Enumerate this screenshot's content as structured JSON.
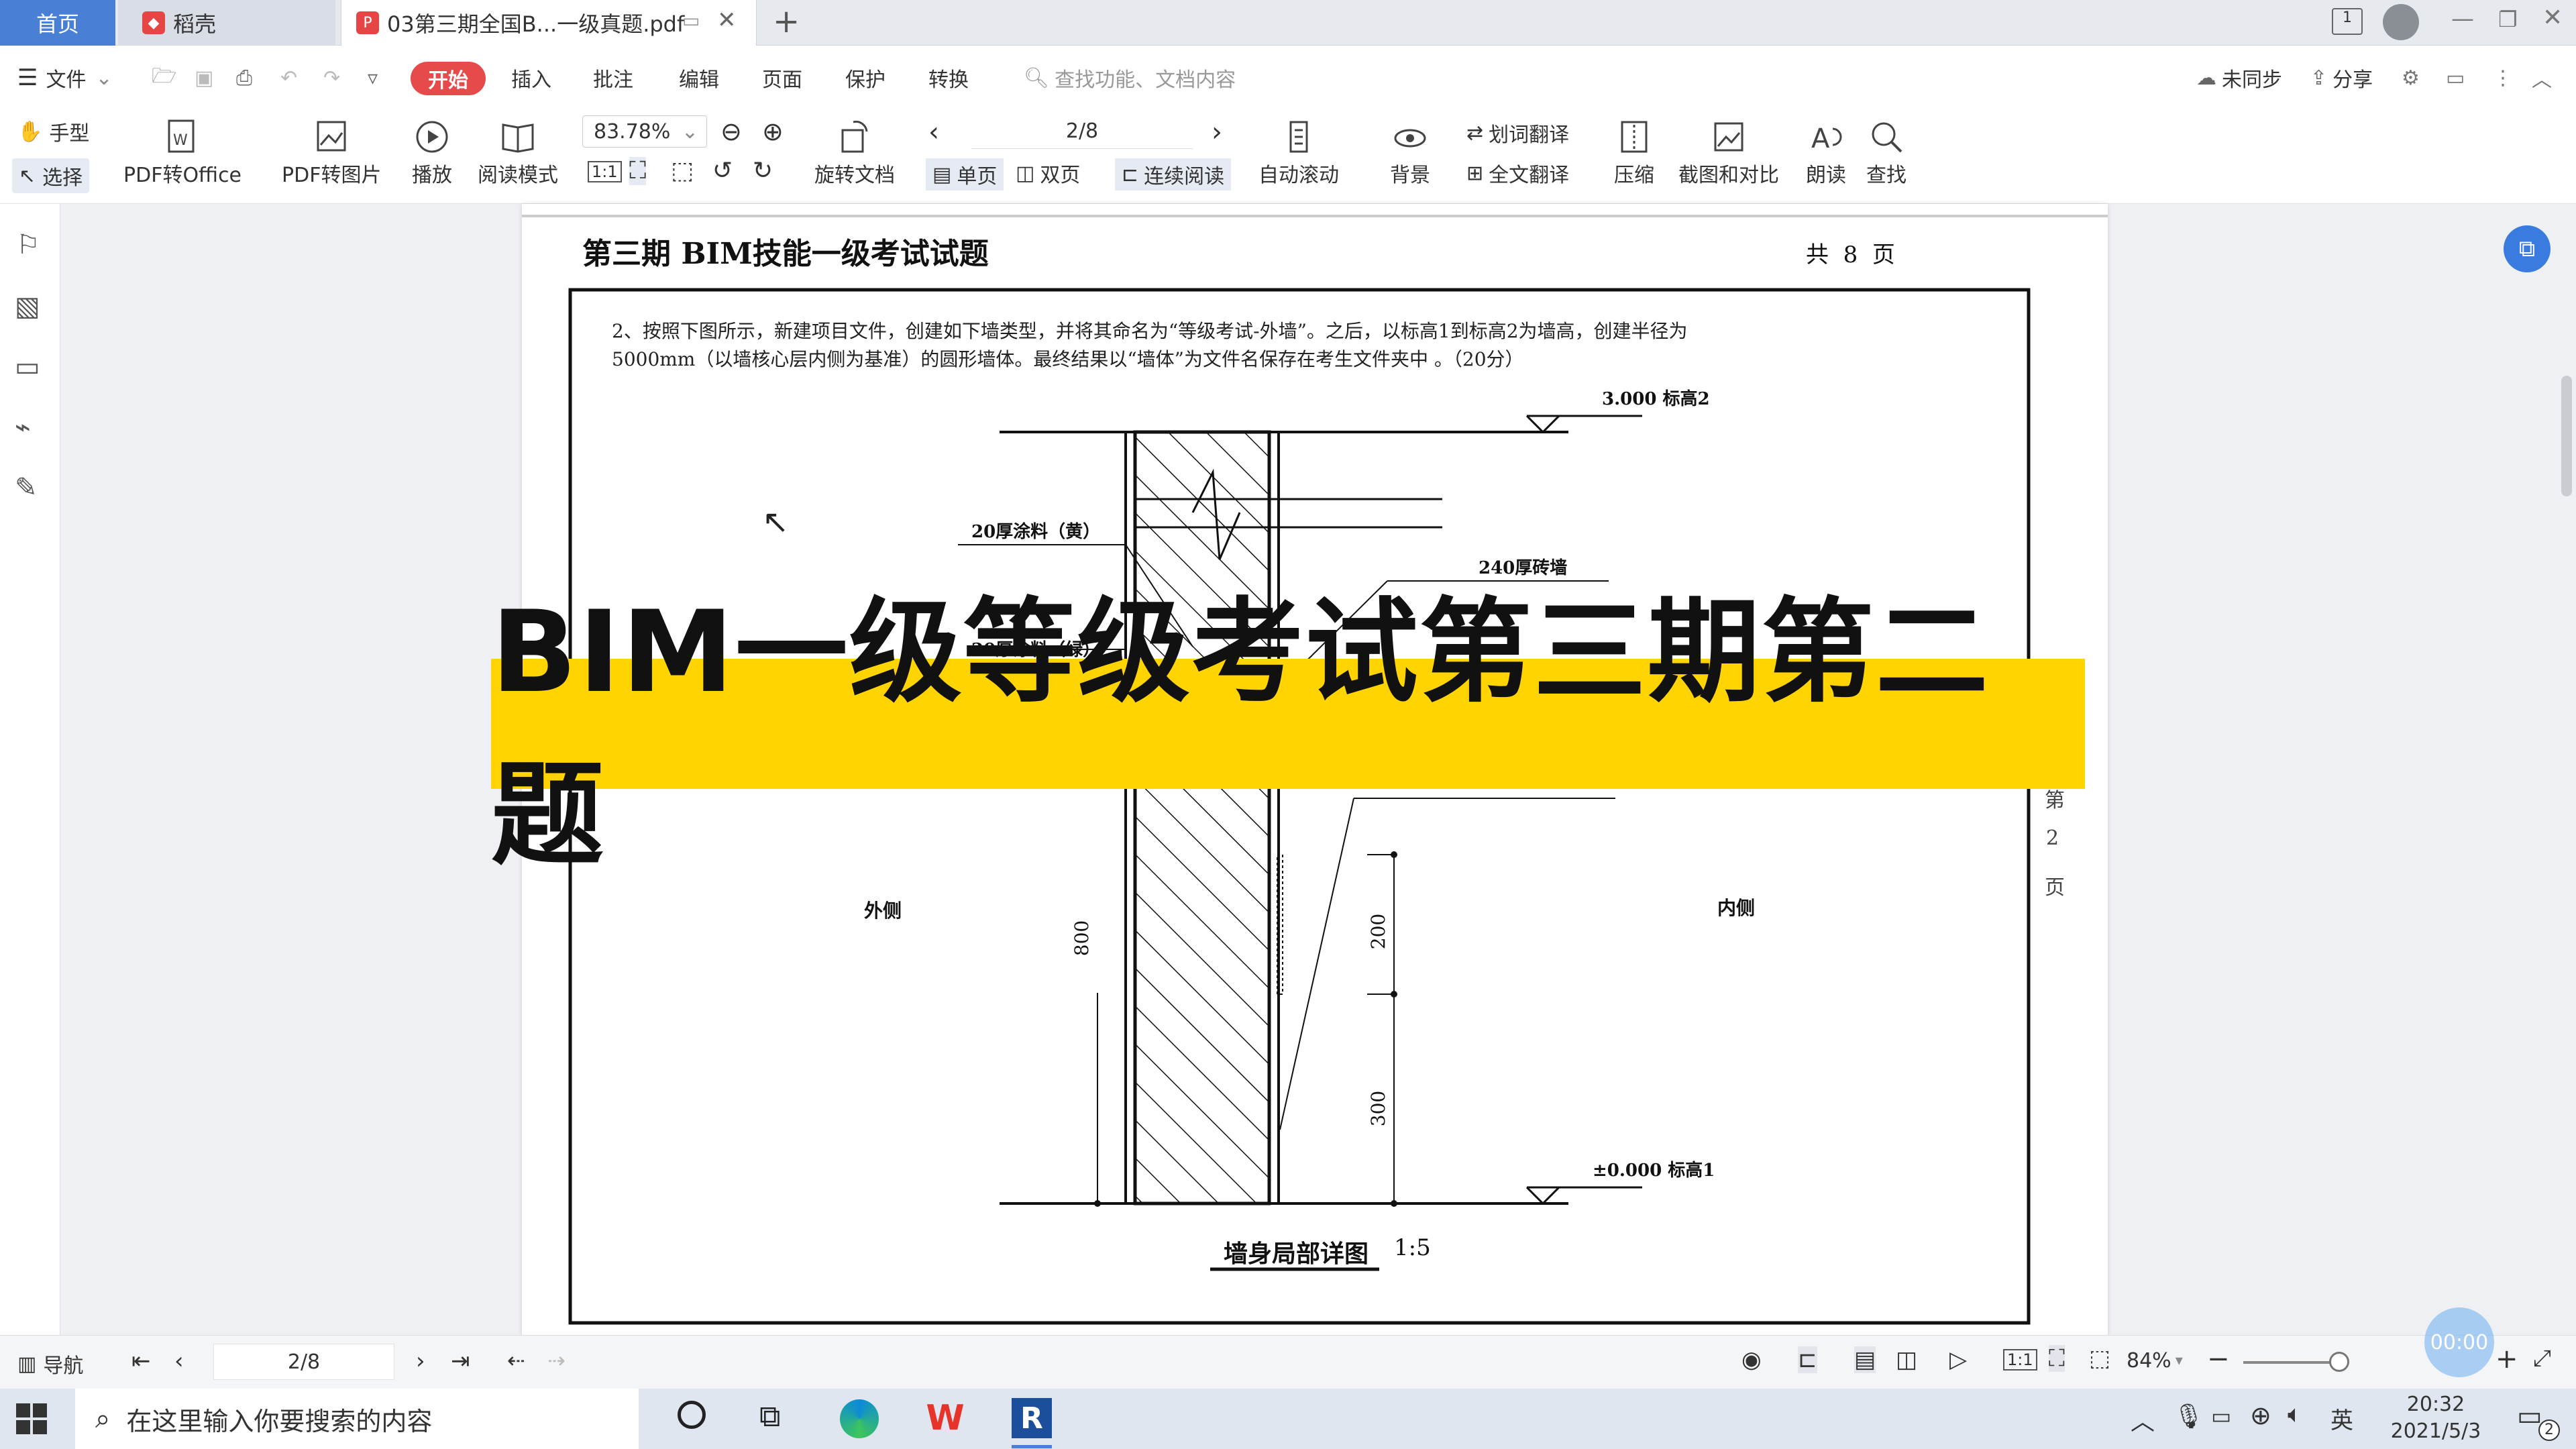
{
  "tabs": [
    {
      "label": "首页"
    },
    {
      "label": "稻壳"
    },
    {
      "label": "03第三期全国B...一级真题.pdf"
    }
  ],
  "menu": {
    "file": "文件",
    "items": [
      "开始",
      "插入",
      "批注",
      "编辑",
      "页面",
      "保护",
      "转换"
    ],
    "search_placeholder": "查找功能、文档内容",
    "sync": "未同步",
    "share": "分享"
  },
  "toolbar": {
    "hand": "手型",
    "select": "选择",
    "pdf_to_office": "PDF转Office",
    "pdf_to_image": "PDF转图片",
    "play": "播放",
    "read_mode": "阅读模式",
    "zoom": "83.78%",
    "rotate": "旋转文档",
    "page": "2/8",
    "single": "单页",
    "double": "双页",
    "continuous": "连续阅读",
    "auto_scroll": "自动滚动",
    "background": "背景",
    "word_translate": "划词翻译",
    "full_translate": "全文翻译",
    "compress": "压缩",
    "screenshot": "截图和对比",
    "read_aloud": "朗读",
    "find": "查找"
  },
  "document": {
    "header_title": "第三期 BIM技能一级考试试题",
    "header_pages": "共  8  页",
    "question_line1": "2、按照下图所示，新建项目文件，创建如下墙类型，并将其命名为“等级考试-外墙”。之后，以标高1到标高2为墙高，创建半径为",
    "question_line2": "5000mm（以墙核心层内侧为基准）的圆形墙体。最终结果以“墙体”为文件名保存在考生文件夹中 。（20分）",
    "level2": "3.000 标高2",
    "level1": "±0.000 标高1",
    "label_yellow": "20厚涂料（黄）",
    "label_green": "20厚涂料（绿）",
    "label_brick": "240厚砖墙",
    "outside": "外侧",
    "inside": "内侧",
    "dim_800": "800",
    "dim_200": "200",
    "dim_300": "300",
    "drawing_title": "墙身局部详图",
    "drawing_scale": "1:5",
    "side_page_a": "第",
    "side_page_b": "2",
    "side_page_c": "页"
  },
  "banner": "BIM一级等级考试第三期第二题",
  "statusbar": {
    "nav": "导航",
    "page": "2/8",
    "zoom": "84%",
    "timer": "00:00"
  },
  "taskbar": {
    "search_placeholder": "在这里输入你要搜索的内容",
    "ime": "英",
    "time": "20:32",
    "date": "2021/5/3",
    "notif": "2"
  },
  "colors": {
    "accent": "#4a7fd6",
    "start": "#e64a4a",
    "banner": "#ffd400"
  }
}
